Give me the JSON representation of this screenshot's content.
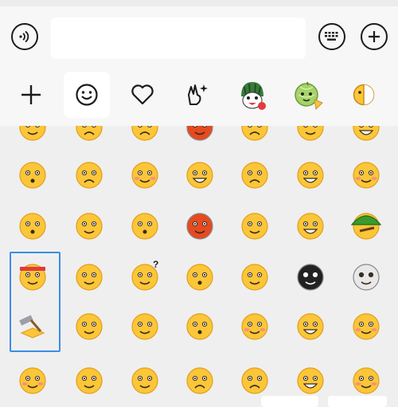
{
  "input_bar": {
    "voice_icon": "voice-icon",
    "text_value": "",
    "keyboard_icon": "keyboard-icon",
    "more_icon": "plus-circle-icon"
  },
  "tabs": [
    {
      "icon": "add-icon",
      "active": false
    },
    {
      "icon": "smiley-icon",
      "active": true
    },
    {
      "icon": "heart-icon",
      "active": false
    },
    {
      "icon": "sparkle-hand-icon",
      "active": false
    },
    {
      "icon": "watermelon-character-icon",
      "active": false
    },
    {
      "icon": "melon-character-icon",
      "active": false
    },
    {
      "icon": "half-face-icon",
      "active": false
    }
  ],
  "emoji_rows": [
    [
      "bandaged-face",
      "crying",
      "sobbing",
      "angry-red",
      "frown",
      "tongue-out",
      "grin-teeth"
    ],
    [
      "shocked",
      "sad",
      "blushing-wide-eyes",
      "screaming",
      "worried",
      "facepalm-laugh",
      "smiling-blush"
    ],
    [
      "surprised-round",
      "side-eye",
      "blank-stare",
      "furious",
      "smirk-sweat",
      "grin-squint",
      "green-hat"
    ],
    [
      "ninja-headband",
      "drooling",
      "confused-question",
      "shush",
      "dizzy-eyes",
      "skull-bomb",
      "skull"
    ],
    [
      "hammer-bow",
      "peeking",
      "sweat-drop",
      "puckered",
      "covering-mouth",
      "big-grin-teeth",
      "wink-blush"
    ],
    [
      "sly",
      "nose-pick",
      "double-punch",
      "pleading",
      "teary-content",
      "laughing-squint",
      "sheepish"
    ]
  ],
  "colors": {
    "emoji_yellow": "#fbc638",
    "emoji_outline": "#e29e1c",
    "selection": "#3a8ee6",
    "red_face": "#e54a20"
  }
}
